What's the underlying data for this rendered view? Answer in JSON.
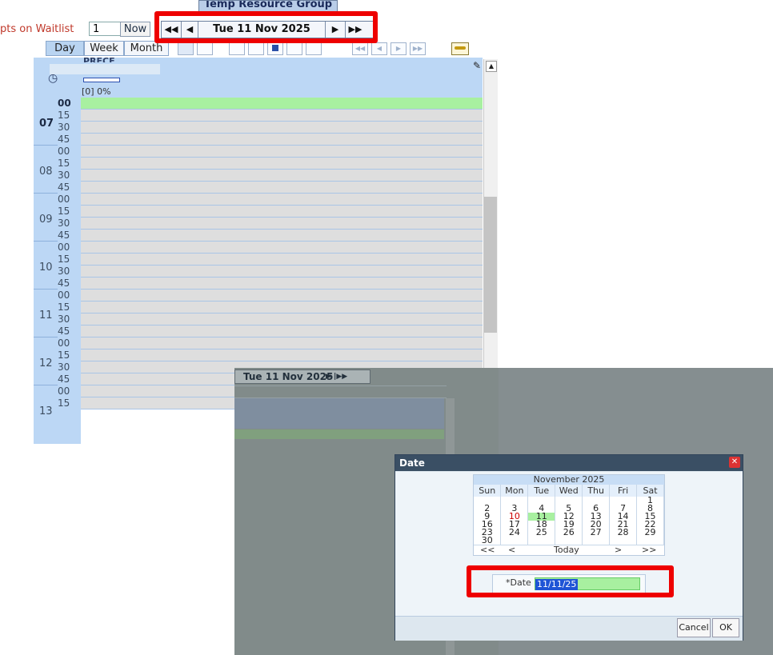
{
  "header": {
    "group_title": "Temp Resource Group",
    "waitlist_label": "pts on Waitlist",
    "waitlist_value": "1",
    "now_label": "Now",
    "date_display": "Tue 11 Nov 2025"
  },
  "view_tabs": [
    "Day",
    "Week",
    "Month"
  ],
  "resource": {
    "name": "PRECE",
    "progress_text": "[0] 0%"
  },
  "time_slots": [
    {
      "hour": "07",
      "minutes": [
        "00",
        "15",
        "30",
        "45"
      ]
    },
    {
      "hour": "08",
      "minutes": [
        "00",
        "15",
        "30",
        "45"
      ]
    },
    {
      "hour": "09",
      "minutes": [
        "00",
        "15",
        "30",
        "45"
      ]
    },
    {
      "hour": "10",
      "minutes": [
        "00",
        "15",
        "30",
        "45"
      ]
    },
    {
      "hour": "11",
      "minutes": [
        "00",
        "15",
        "30",
        "45"
      ]
    },
    {
      "hour": "12",
      "minutes": [
        "00",
        "15",
        "30",
        "45"
      ]
    },
    {
      "hour": "13",
      "minutes": [
        "00",
        "15"
      ]
    }
  ],
  "dialog": {
    "title": "Date",
    "month_label": "November 2025",
    "weekdays": [
      "Sun",
      "Mon",
      "Tue",
      "Wed",
      "Thu",
      "Fri",
      "Sat"
    ],
    "weeks": [
      [
        "",
        "",
        "",
        "",
        "",
        "",
        "1"
      ],
      [
        "2",
        "3",
        "4",
        "5",
        "6",
        "7",
        "8"
      ],
      [
        "9",
        "10",
        "11",
        "12",
        "13",
        "14",
        "15"
      ],
      [
        "16",
        "17",
        "18",
        "19",
        "20",
        "21",
        "22"
      ],
      [
        "23",
        "24",
        "25",
        "26",
        "27",
        "28",
        "29"
      ],
      [
        "30",
        "",
        "",
        "",
        "",
        "",
        ""
      ]
    ],
    "nav": {
      "prev_year": "<<",
      "prev_month": "<",
      "today": "Today",
      "next_month": ">",
      "next_year": ">>"
    },
    "date_label": "*Date",
    "date_value": "11/11/25",
    "cancel_label": "Cancel",
    "ok_label": "OK"
  },
  "colors": {
    "highlight_red": "#ee0000",
    "today_green": "#a8f0a0",
    "holiday_red": "#cc0000",
    "header_blue": "#bcd7f5",
    "overlay_gray": "#7f8b8b"
  }
}
